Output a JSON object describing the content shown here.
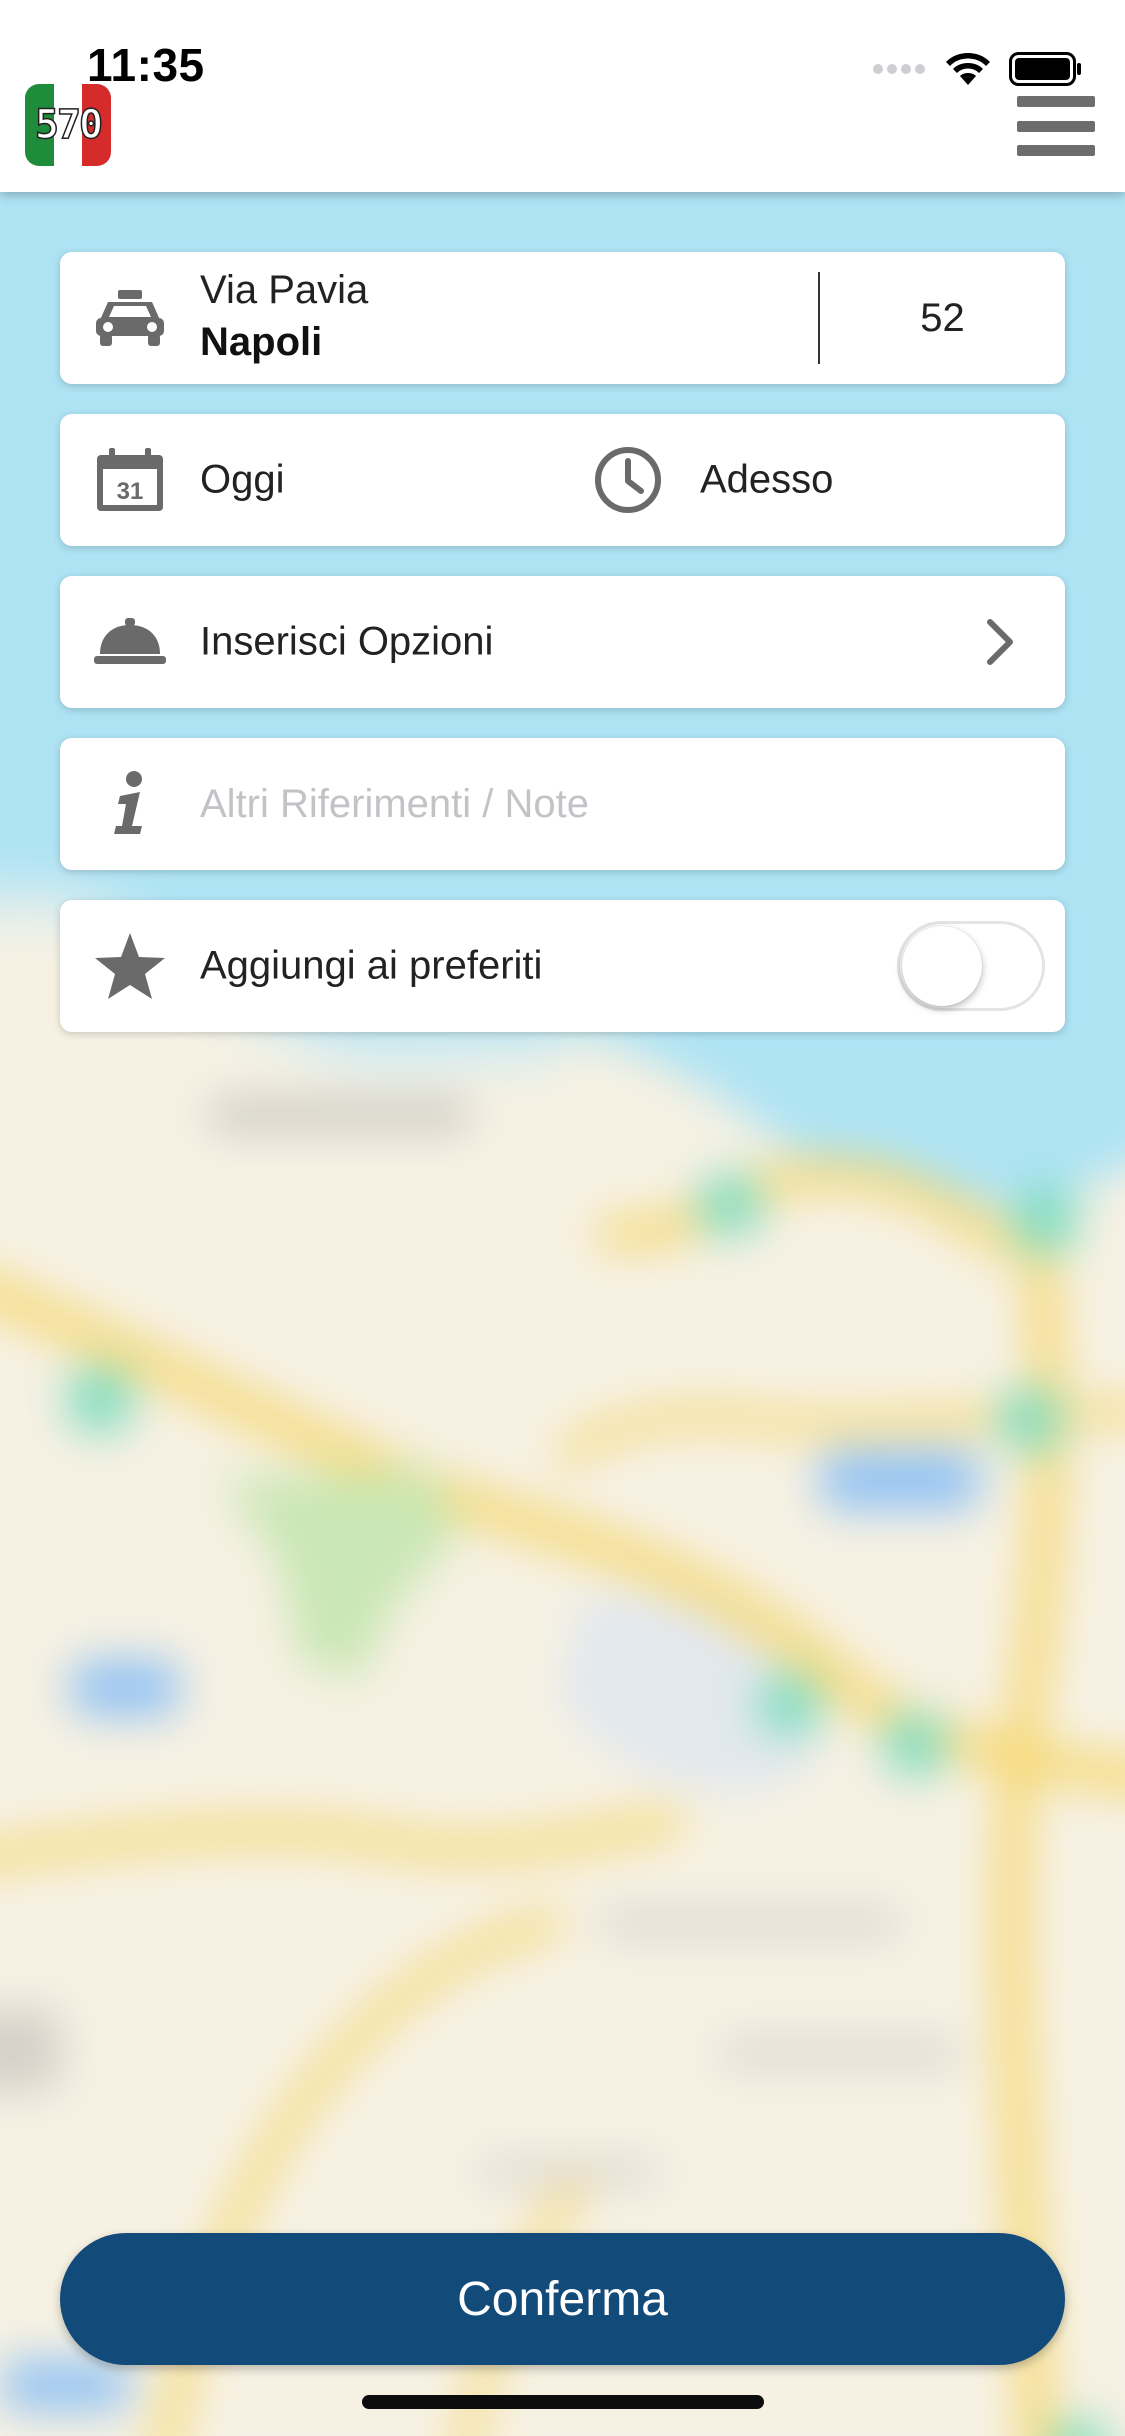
{
  "status_bar": {
    "time": "11:35"
  },
  "header": {
    "logo_text": "570",
    "logo_colors": [
      "#1e8c3a",
      "#ffffff",
      "#d52b2b"
    ],
    "menu_icon": "hamburger-menu-icon"
  },
  "address": {
    "icon": "taxi-icon",
    "street": "Via Pavia",
    "city": "Napoli",
    "number": "52"
  },
  "schedule": {
    "date_icon": "calendar-icon",
    "date_icon_day": "31",
    "date_label": "Oggi",
    "time_icon": "clock-icon",
    "time_label": "Adesso"
  },
  "options": {
    "icon": "service-bell-icon",
    "label": "Inserisci Opzioni",
    "chevron_icon": "chevron-right-icon"
  },
  "notes": {
    "icon": "info-icon",
    "value": "",
    "placeholder": "Altri Riferimenti / Note"
  },
  "favorites": {
    "icon": "star-icon",
    "label": "Aggiungi ai preferiti",
    "toggle_on": false
  },
  "confirm": {
    "label": "Conferma",
    "color": "#124a7a"
  }
}
